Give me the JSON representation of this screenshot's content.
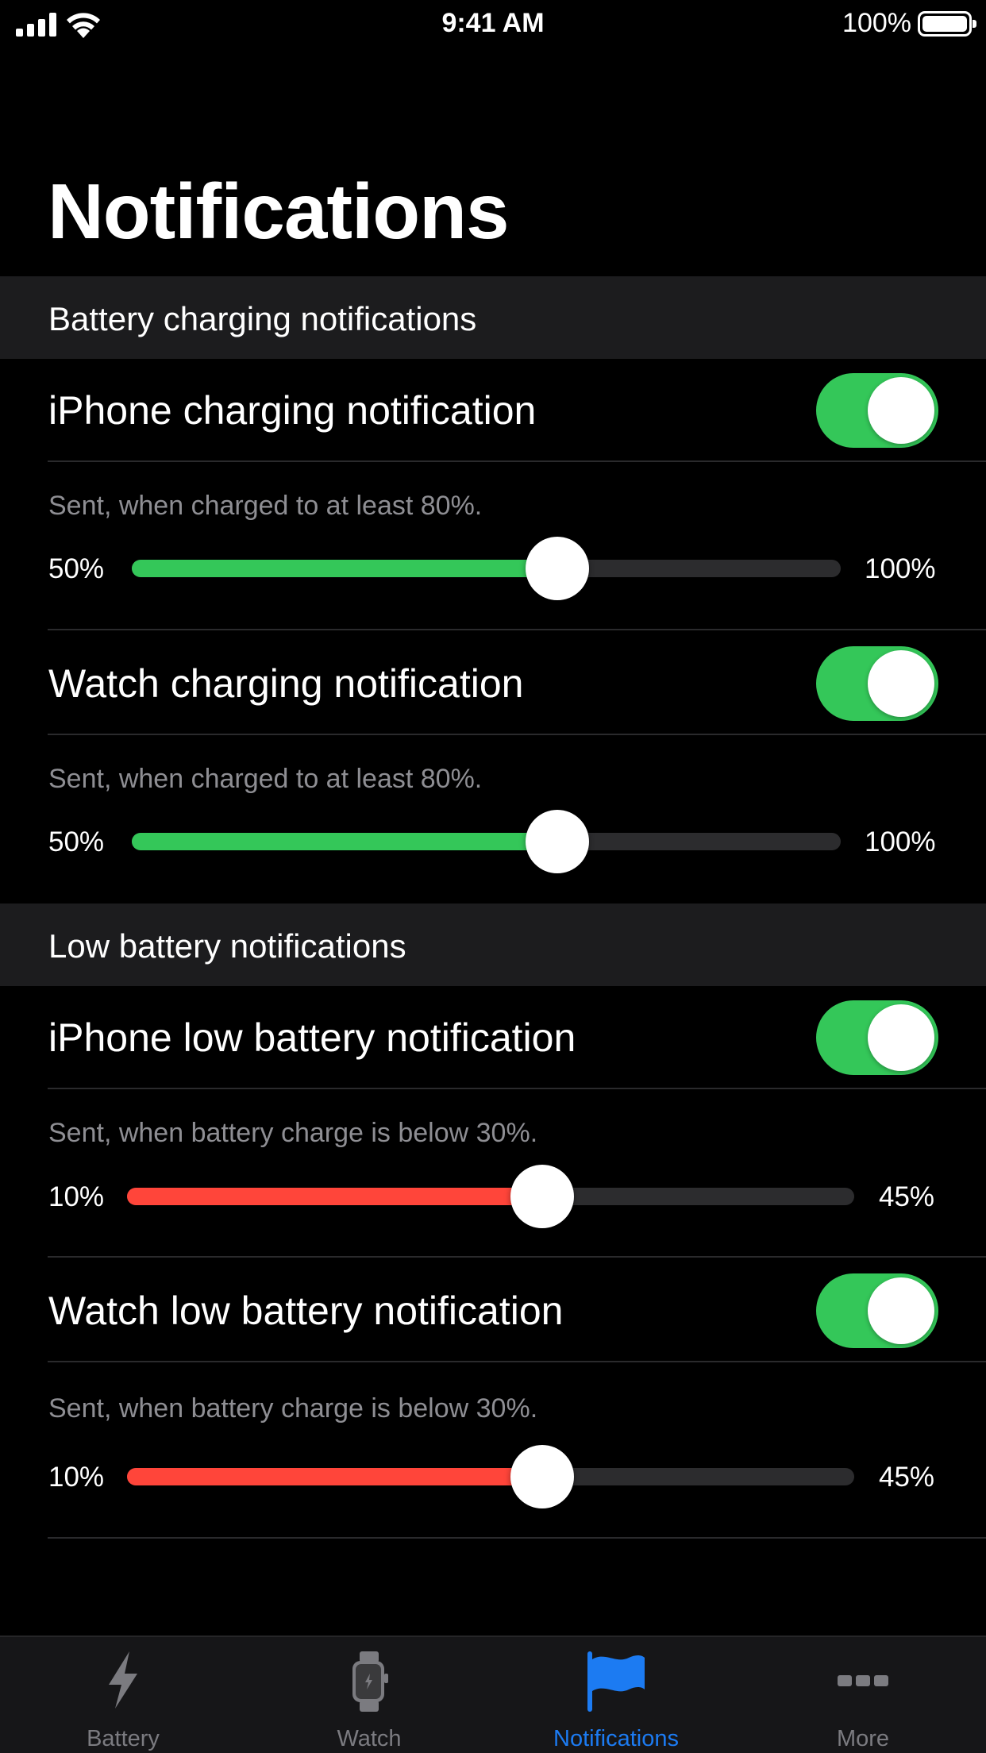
{
  "status_bar": {
    "time": "9:41 AM",
    "battery_percent": "100%"
  },
  "page_title": "Notifications",
  "sections": [
    {
      "header": "Battery charging notifications",
      "accent_color": "#34c759",
      "rows": [
        {
          "title": "iPhone charging notification",
          "enabled": true,
          "description": "Sent, when charged to at least 80%.",
          "min_label": "50%",
          "max_label": "100%",
          "slider_min": 50,
          "slider_max": 100,
          "slider_value": 80
        },
        {
          "title": "Watch charging notification",
          "enabled": true,
          "description": "Sent, when charged to at least 80%.",
          "min_label": "50%",
          "max_label": "100%",
          "slider_min": 50,
          "slider_max": 100,
          "slider_value": 80
        }
      ]
    },
    {
      "header": "Low battery notifications",
      "accent_color": "#ff453a",
      "rows": [
        {
          "title": "iPhone low battery notification",
          "enabled": true,
          "description": "Sent, when battery charge is below 30%.",
          "min_label": "10%",
          "max_label": "45%",
          "slider_min": 10,
          "slider_max": 45,
          "slider_value": 30
        },
        {
          "title": "Watch low battery notification",
          "enabled": true,
          "description": "Sent, when battery charge is below 30%.",
          "min_label": "10%",
          "max_label": "45%",
          "slider_min": 10,
          "slider_max": 45,
          "slider_value": 30
        }
      ]
    }
  ],
  "tabs": [
    {
      "label": "Battery",
      "icon": "bolt-icon",
      "active": false
    },
    {
      "label": "Watch",
      "icon": "watch-icon",
      "active": false
    },
    {
      "label": "Notifications",
      "icon": "flag-icon",
      "active": true
    },
    {
      "label": "More",
      "icon": "ellipsis-icon",
      "active": false
    }
  ],
  "colors": {
    "toggle_on": "#34c759",
    "tab_active": "#1c7bf2",
    "tab_inactive": "#7b7b80"
  }
}
